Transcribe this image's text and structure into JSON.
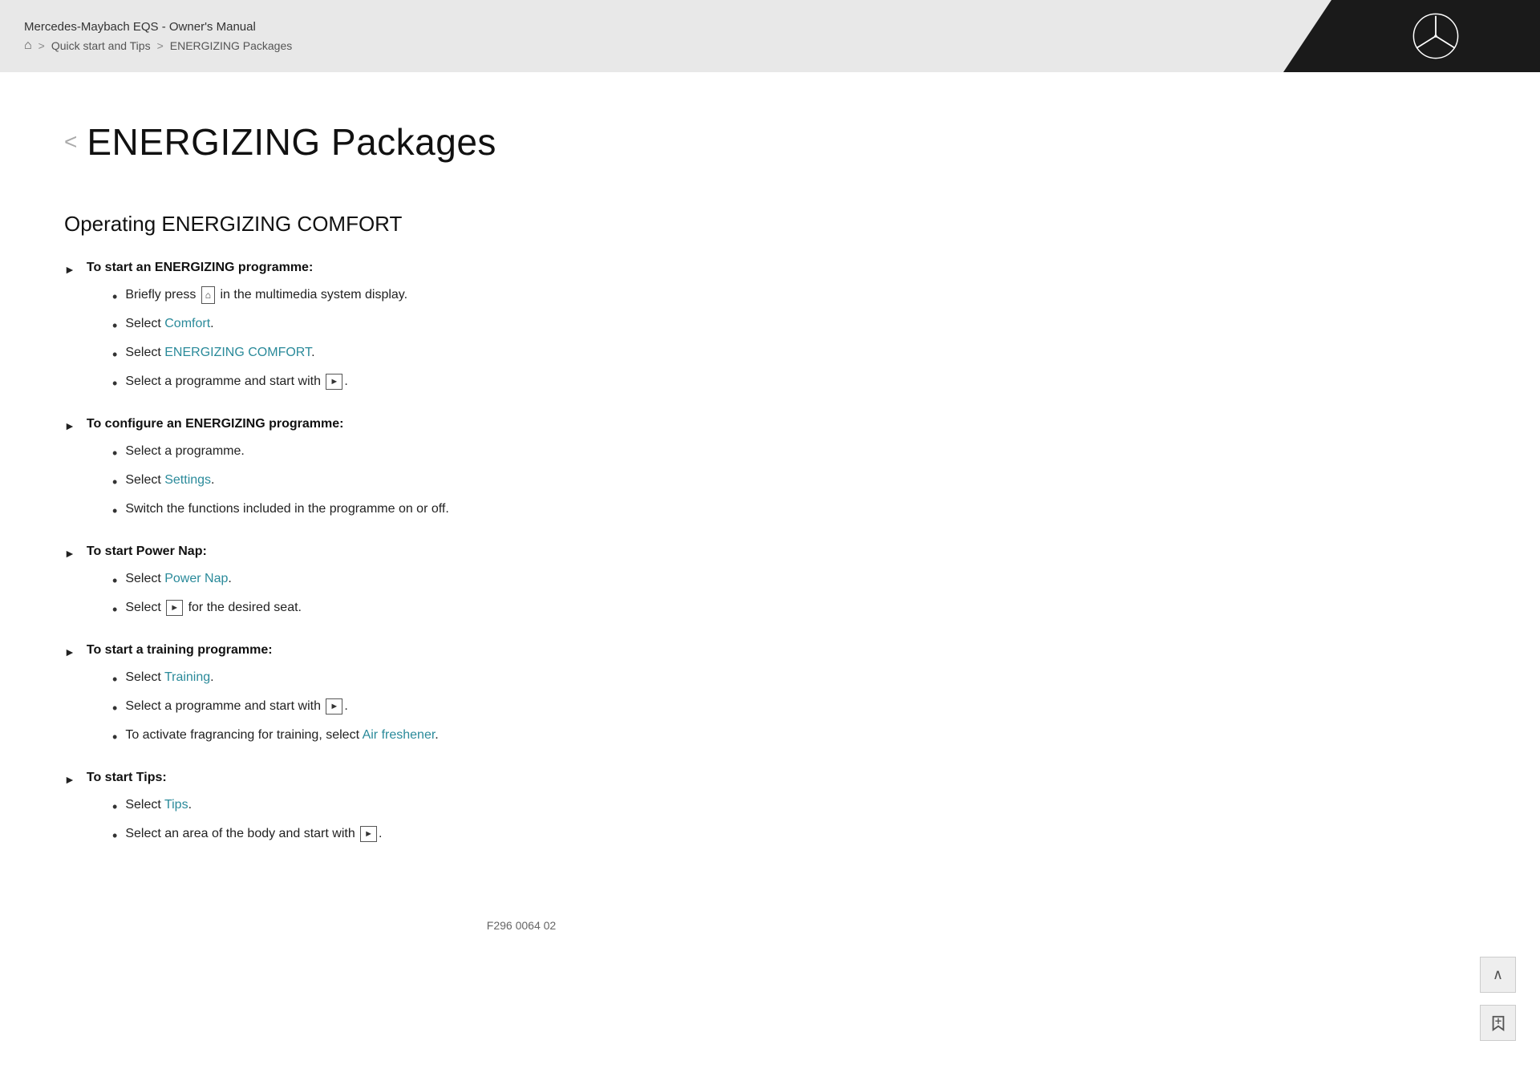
{
  "header": {
    "title": "Mercedes-Maybach EQS - Owner's Manual",
    "breadcrumb": {
      "home_icon": "⌂",
      "separator1": ">",
      "link1": "Quick start and Tips",
      "separator2": ">",
      "current": "ENERGIZING Packages"
    }
  },
  "page": {
    "back_arrow": "<",
    "title": "ENERGIZING Packages"
  },
  "section": {
    "title": "Operating ENERGIZING COMFORT"
  },
  "instructions": [
    {
      "id": "start-programme",
      "header": "To start an ENERGIZING programme:",
      "bullets": [
        {
          "type": "mixed",
          "parts": [
            "Briefly press ",
            "[home]",
            " in the multimedia system display."
          ]
        },
        {
          "type": "mixed",
          "parts": [
            "Select ",
            "Comfort",
            "."
          ]
        },
        {
          "type": "mixed",
          "parts": [
            "Select ",
            "ENERGIZING COMFORT",
            "."
          ]
        },
        {
          "type": "mixed",
          "parts": [
            "Select a programme and start with ",
            "[play]",
            "."
          ]
        }
      ]
    },
    {
      "id": "configure-programme",
      "header": "To configure an ENERGIZING programme:",
      "bullets": [
        {
          "type": "plain",
          "text": "Select a programme."
        },
        {
          "type": "mixed",
          "parts": [
            "Select ",
            "Settings",
            "."
          ]
        },
        {
          "type": "plain",
          "text": "Switch the functions included in the programme on or off."
        }
      ]
    },
    {
      "id": "start-power-nap",
      "header": "To start Power Nap:",
      "bullets": [
        {
          "type": "mixed",
          "parts": [
            "Select ",
            "Power Nap",
            "."
          ]
        },
        {
          "type": "mixed",
          "parts": [
            "Select ",
            "[play]",
            " for the desired seat."
          ]
        }
      ]
    },
    {
      "id": "start-training",
      "header": "To start a training programme:",
      "bullets": [
        {
          "type": "mixed",
          "parts": [
            "Select ",
            "Training",
            "."
          ]
        },
        {
          "type": "mixed",
          "parts": [
            "Select a programme and start with ",
            "[play]",
            "."
          ]
        },
        {
          "type": "mixed",
          "parts": [
            "To activate fragrancing for training, select ",
            "Air freshener",
            "."
          ]
        }
      ]
    },
    {
      "id": "start-tips",
      "header": "To start Tips:",
      "bullets": [
        {
          "type": "mixed",
          "parts": [
            "Select ",
            "Tips",
            "."
          ]
        },
        {
          "type": "mixed",
          "parts": [
            "Select an area of the body and start with ",
            "[play]",
            "."
          ]
        }
      ]
    }
  ],
  "footer": {
    "code": "F296 0064 02"
  },
  "ui": {
    "scroll_up": "∧",
    "bookmark": "✕"
  }
}
